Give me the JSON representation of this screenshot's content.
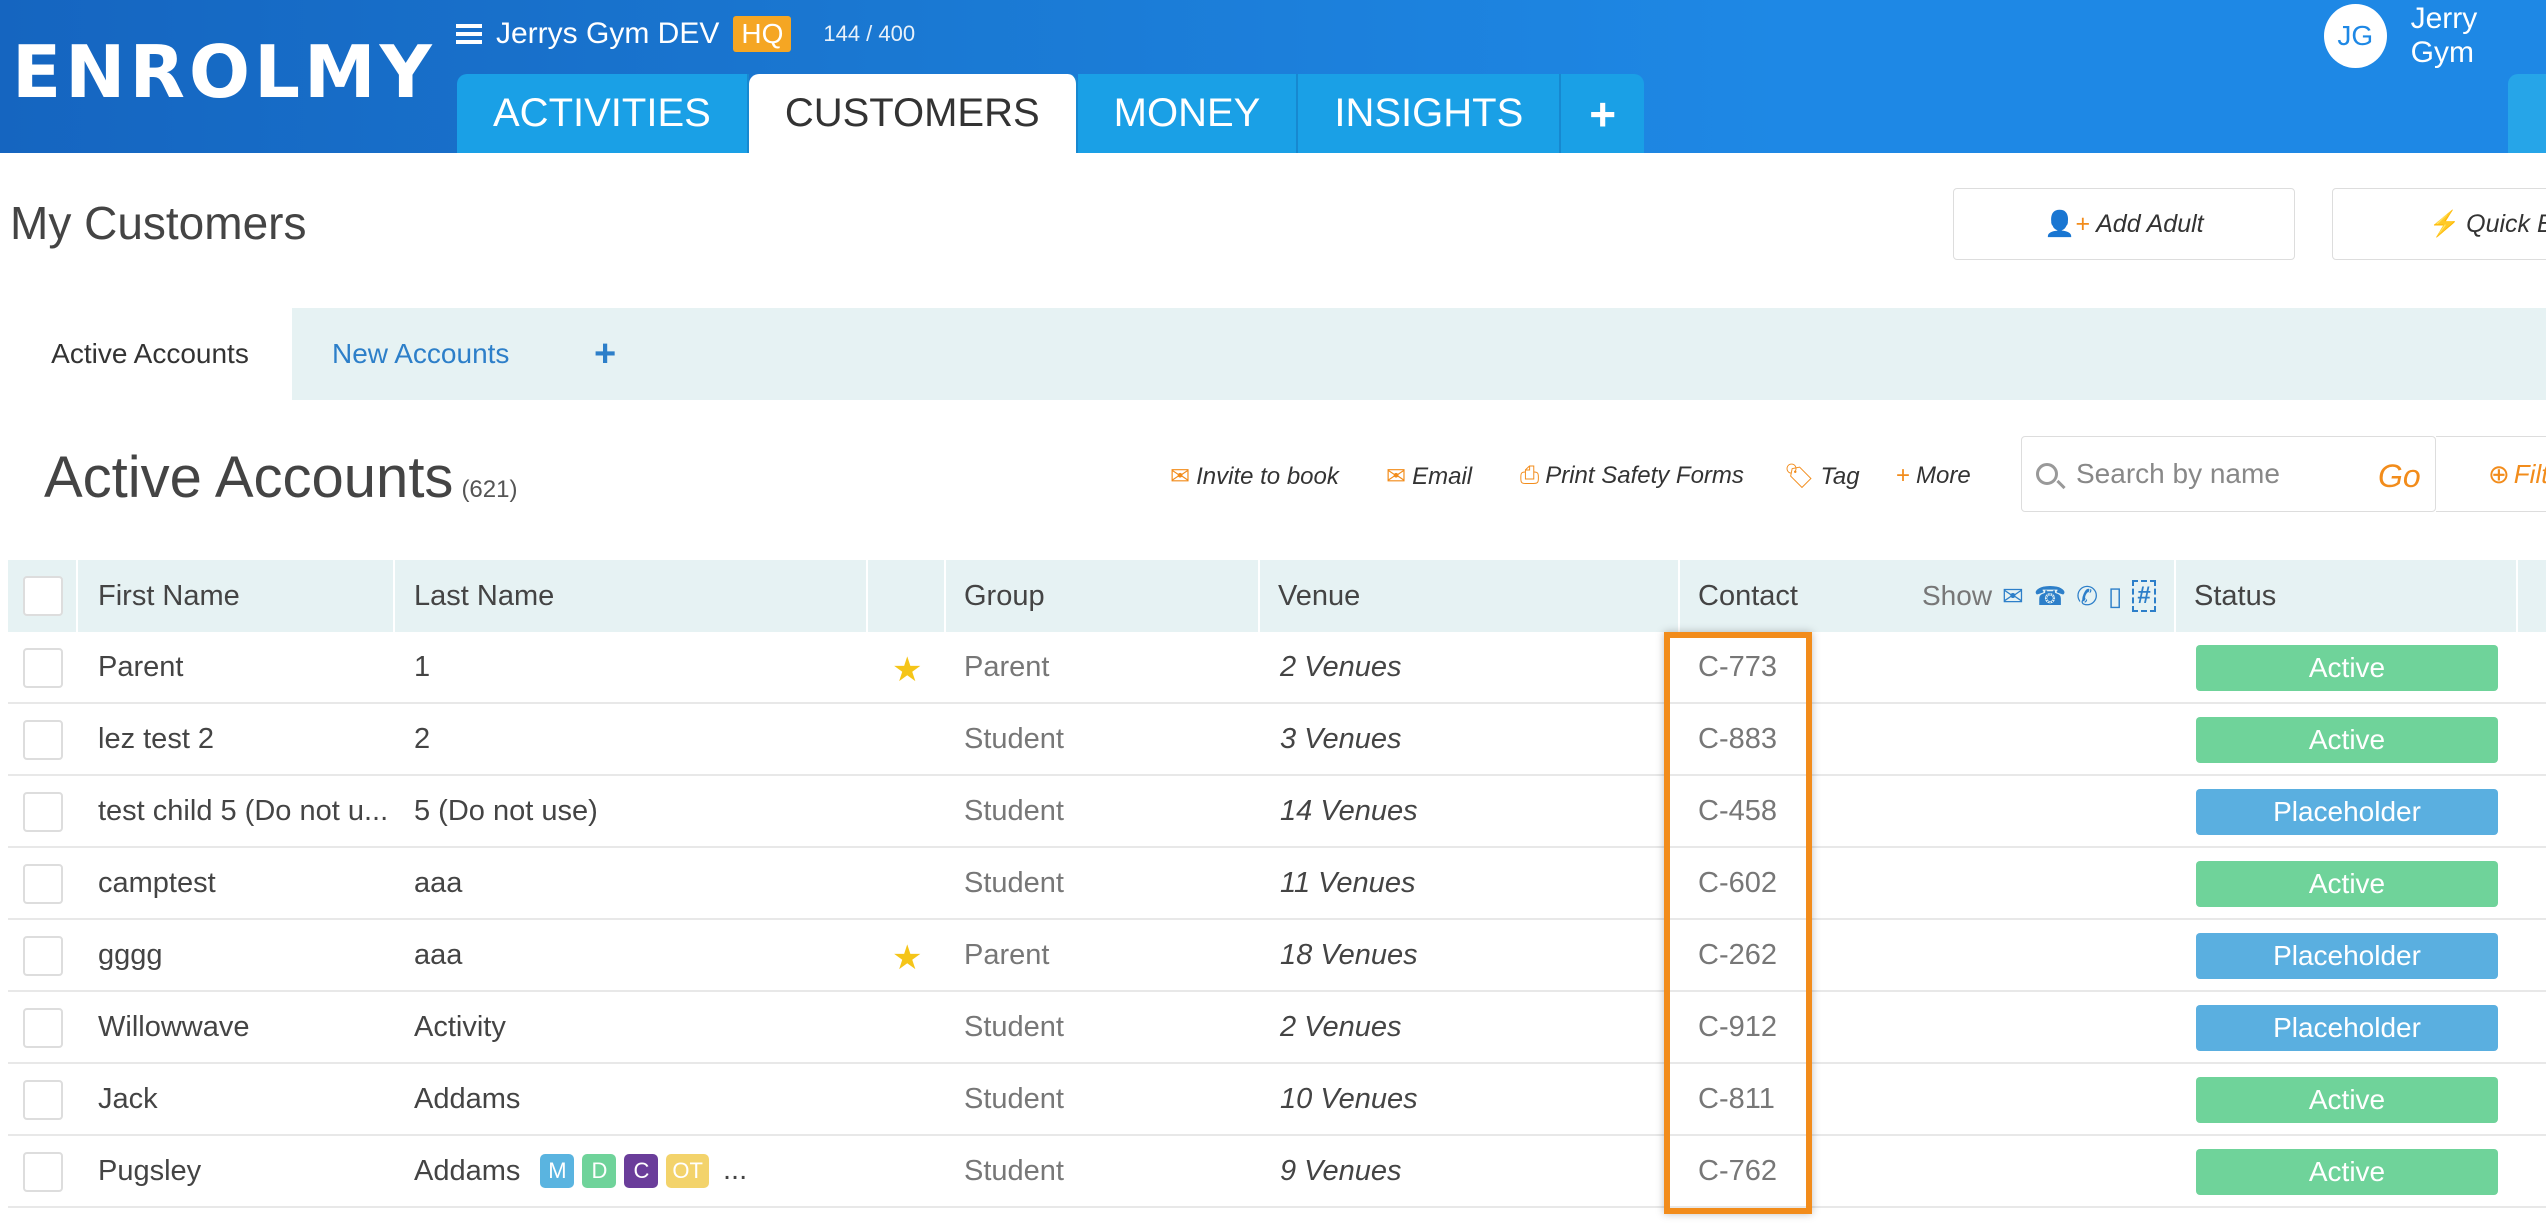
{
  "app": {
    "logo": "ENROLMY",
    "org_name": "Jerrys Gym DEV",
    "org_badge": "HQ",
    "count": "144 / 400",
    "user_initials": "JG",
    "user_name": "Jerry Gym"
  },
  "nav": {
    "tabs": [
      "ACTIVITIES",
      "CUSTOMERS",
      "MONEY",
      "INSIGHTS"
    ],
    "active": "CUSTOMERS",
    "plus": "+"
  },
  "page": {
    "title": "My Customers",
    "add_adult": "Add Adult",
    "quick_book": "Quick Bo"
  },
  "account_tabs": {
    "active": "Active Accounts",
    "new": "New Accounts",
    "plus": "+"
  },
  "section": {
    "title": "Active Accounts",
    "count": "(621)",
    "actions": {
      "invite": "Invite to book",
      "email": "Email",
      "print": "Print Safety Forms",
      "tag": "Tag",
      "more": "More"
    },
    "search_placeholder": "Search by name",
    "go": "Go",
    "filter": "Filt"
  },
  "table": {
    "headers": {
      "first_name": "First Name",
      "last_name": "Last Name",
      "group": "Group",
      "venue": "Venue",
      "contact": "Contact",
      "show": "Show",
      "status": "Status"
    },
    "rows": [
      {
        "first": "Parent",
        "last": "1",
        "star": true,
        "group": "Parent",
        "venue": "2 Venues",
        "contact": "C-773",
        "status": "Active"
      },
      {
        "first": "lez test 2",
        "last": "2",
        "star": false,
        "group": "Student",
        "venue": "3 Venues",
        "contact": "C-883",
        "status": "Active"
      },
      {
        "first": "test child 5 (Do not u...",
        "last": "5 (Do not use)",
        "star": false,
        "group": "Student",
        "venue": "14 Venues",
        "contact": "C-458",
        "status": "Placeholder"
      },
      {
        "first": "camptest",
        "last": "aaa",
        "star": false,
        "group": "Student",
        "venue": "11 Venues",
        "contact": "C-602",
        "status": "Active"
      },
      {
        "first": "gggg",
        "last": "aaa",
        "star": true,
        "group": "Parent",
        "venue": "18 Venues",
        "contact": "C-262",
        "status": "Placeholder"
      },
      {
        "first": "Willowwave",
        "last": "Activity",
        "star": false,
        "group": "Student",
        "venue": "2 Venues",
        "contact": "C-912",
        "status": "Placeholder"
      },
      {
        "first": "Jack",
        "last": "Addams",
        "star": false,
        "group": "Student",
        "venue": "10 Venues",
        "contact": "C-811",
        "status": "Active"
      },
      {
        "first": "Pugsley",
        "last": "Addams",
        "star": false,
        "group": "Student",
        "venue": "9 Venues",
        "contact": "C-762",
        "status": "Active",
        "badges": [
          {
            "label": "M",
            "color": "#5ab4e0"
          },
          {
            "label": "D",
            "color": "#6fd39a"
          },
          {
            "label": "C",
            "color": "#6a3d9a"
          },
          {
            "label": "OT",
            "color": "#f3d36b"
          }
        ],
        "badges_more": "..."
      }
    ]
  },
  "colors": {
    "brand": "#1e88e5",
    "accent": "#f28c1b",
    "active": "#6fd39a",
    "placeholder": "#5aafe0"
  }
}
